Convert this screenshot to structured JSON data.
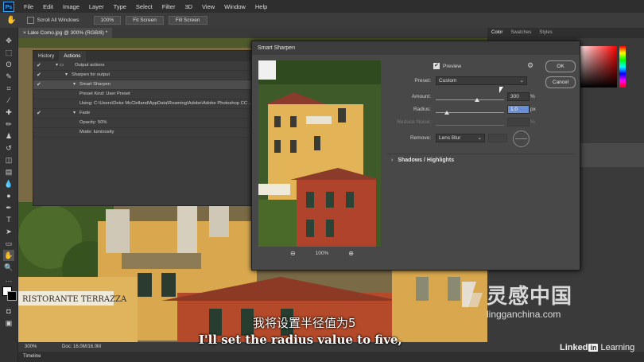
{
  "app": {
    "logo": "Ps"
  },
  "menu": [
    "File",
    "Edit",
    "Image",
    "Layer",
    "Type",
    "Select",
    "Filter",
    "3D",
    "View",
    "Window",
    "Help"
  ],
  "options_bar": {
    "scroll_all": "Scroll All Windows",
    "zoom_btn": "100%",
    "fit_btn": "Fit Screen",
    "fill_btn": "Fill Screen"
  },
  "document": {
    "tab": "Lake Como.jpg @ 300% (RGB/8) *",
    "status_zoom": "300%",
    "status_doc": "Doc: 16.0M/16.0M"
  },
  "actions_panel": {
    "tabs": [
      "History",
      "Actions"
    ],
    "rows": [
      "Output actions",
      "Sharpen for output",
      "Smart Sharpen",
      "Preset Kind: User Preset",
      "Using: C:\\Users\\Deke McClelland\\AppData\\Roaming\\Adobe\\Adobe Photoshop CC ...",
      "Fade",
      "Opacity: 50%",
      "Mode: luminosity"
    ]
  },
  "right_panel": {
    "tabs": [
      "Color",
      "Swatches",
      "Styles"
    ]
  },
  "dialog": {
    "title": "Smart Sharpen",
    "preview_label": "Preview",
    "preview_zoom": "100%",
    "ok": "OK",
    "cancel": "Cancel",
    "preset_label": "Preset:",
    "preset_value": "Custom",
    "amount_label": "Amount:",
    "amount_value": "300",
    "amount_unit": "%",
    "amount_fraction": 0.6,
    "radius_label": "Radius:",
    "radius_value": "1.0",
    "radius_unit": "px",
    "radius_fraction": 0.16,
    "noise_label": "Reduce Noise:",
    "noise_unit": "%",
    "remove_label": "Remove:",
    "remove_value": "Lens Blur",
    "shadows_label": "Shadows / Highlights"
  },
  "timeline": "Timeline",
  "subtitles": {
    "cn": "我将设置半径值为5",
    "en": "I'll set the radius value to five,"
  },
  "watermark": {
    "cn": "灵感中国",
    "en": "lingganchina.com",
    "linkedin": "Linked",
    "linkedin_in": "in",
    "learning": "Learning"
  }
}
